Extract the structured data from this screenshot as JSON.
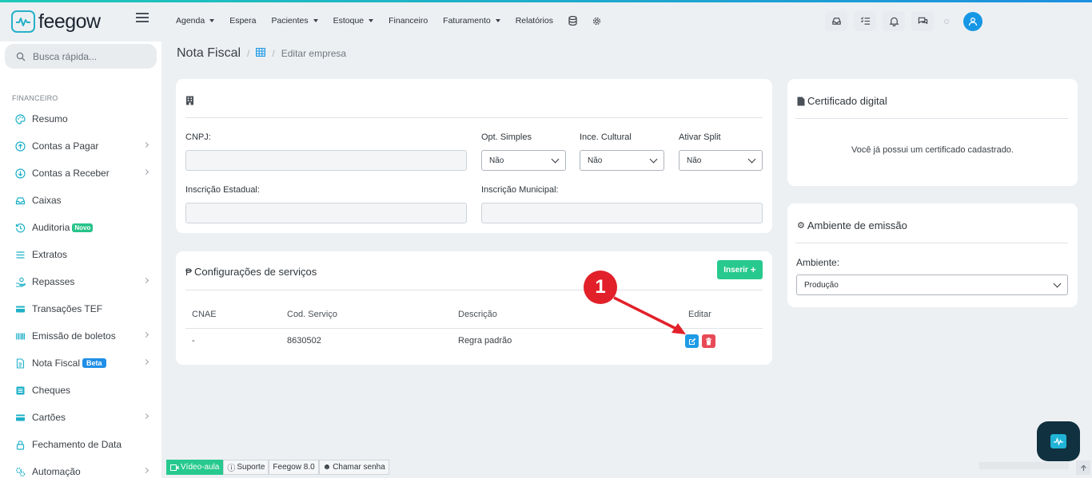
{
  "app": {
    "name": "feegow"
  },
  "topnav": [
    {
      "label": "Agenda",
      "caret": true
    },
    {
      "label": "Espera",
      "caret": false
    },
    {
      "label": "Pacientes",
      "caret": true
    },
    {
      "label": "Estoque",
      "caret": true
    },
    {
      "label": "Financeiro",
      "caret": false
    },
    {
      "label": "Faturamento",
      "caret": true
    },
    {
      "label": "Relatórios",
      "caret": false
    }
  ],
  "topnav_icons": [
    "database-icon",
    "gear-icon"
  ],
  "top_right_icons": [
    "inbox-icon",
    "checklist-icon",
    "bell-icon",
    "chat-icon"
  ],
  "search": {
    "placeholder": "Busca rápida..."
  },
  "sidebar": {
    "section": "FINANCEIRO",
    "items": [
      {
        "label": "Resumo",
        "icon": "palette-icon",
        "chevron": false,
        "badge": ""
      },
      {
        "label": "Contas a Pagar",
        "icon": "arrow-up-circle-icon",
        "chevron": true,
        "badge": ""
      },
      {
        "label": "Contas a Receber",
        "icon": "arrow-down-circle-icon",
        "chevron": true,
        "badge": ""
      },
      {
        "label": "Caixas",
        "icon": "inbox-icon",
        "chevron": false,
        "badge": ""
      },
      {
        "label": "Auditoria",
        "icon": "history-icon",
        "chevron": false,
        "badge": "Novo"
      },
      {
        "label": "Extratos",
        "icon": "list-icon",
        "chevron": false,
        "badge": ""
      },
      {
        "label": "Repasses",
        "icon": "hand-coins-icon",
        "chevron": true,
        "badge": ""
      },
      {
        "label": "Transações TEF",
        "icon": "credit-card-icon",
        "chevron": false,
        "badge": ""
      },
      {
        "label": "Emissão de boletos",
        "icon": "barcode-icon",
        "chevron": true,
        "badge": ""
      },
      {
        "label": "Nota Fiscal",
        "icon": "document-icon",
        "chevron": true,
        "badge": "Beta"
      },
      {
        "label": "Cheques",
        "icon": "check-list-icon",
        "chevron": false,
        "badge": ""
      },
      {
        "label": "Cartões",
        "icon": "credit-card-icon",
        "chevron": true,
        "badge": ""
      },
      {
        "label": "Fechamento de Data",
        "icon": "lock-icon",
        "chevron": false,
        "badge": ""
      },
      {
        "label": "Automação",
        "icon": "gears-icon",
        "chevron": true,
        "badge": ""
      }
    ]
  },
  "breadcrumb": {
    "title": "Nota Fiscal",
    "current": "Editar empresa"
  },
  "company_card": {
    "fields": {
      "cnpj_label": "CNPJ:",
      "simples_label": "Opt. Simples",
      "simples_value": "Não",
      "cultural_label": "Ince. Cultural",
      "cultural_value": "Não",
      "split_label": "Ativar Split",
      "split_value": "Não",
      "ie_label": "Inscrição Estadual:",
      "im_label": "Inscrição Municipal:"
    }
  },
  "services_card": {
    "title": "Configurações de serviços",
    "insert_label": "Inserir",
    "columns": [
      "CNAE",
      "Cod. Serviço",
      "Descrição",
      "Editar"
    ],
    "rows": [
      {
        "cnae": "-",
        "code": "8630502",
        "description": "Regra padrão"
      }
    ]
  },
  "certificate_card": {
    "title": "Certificado digital",
    "message": "Você já possui um certificado cadastrado."
  },
  "environment_card": {
    "title": "Ambiente de emissão",
    "label": "Ambiente:",
    "value": "Produção"
  },
  "annotation": {
    "number": "1"
  },
  "bottombar": {
    "video": "Vídeo-aula",
    "support": "Suporte",
    "version": "Feegow 8.0",
    "call": "Chamar senha"
  },
  "colors": {
    "accent": "#1697e6",
    "green": "#27c98f",
    "danger": "#e2202a",
    "teal": "#26b0c9"
  }
}
